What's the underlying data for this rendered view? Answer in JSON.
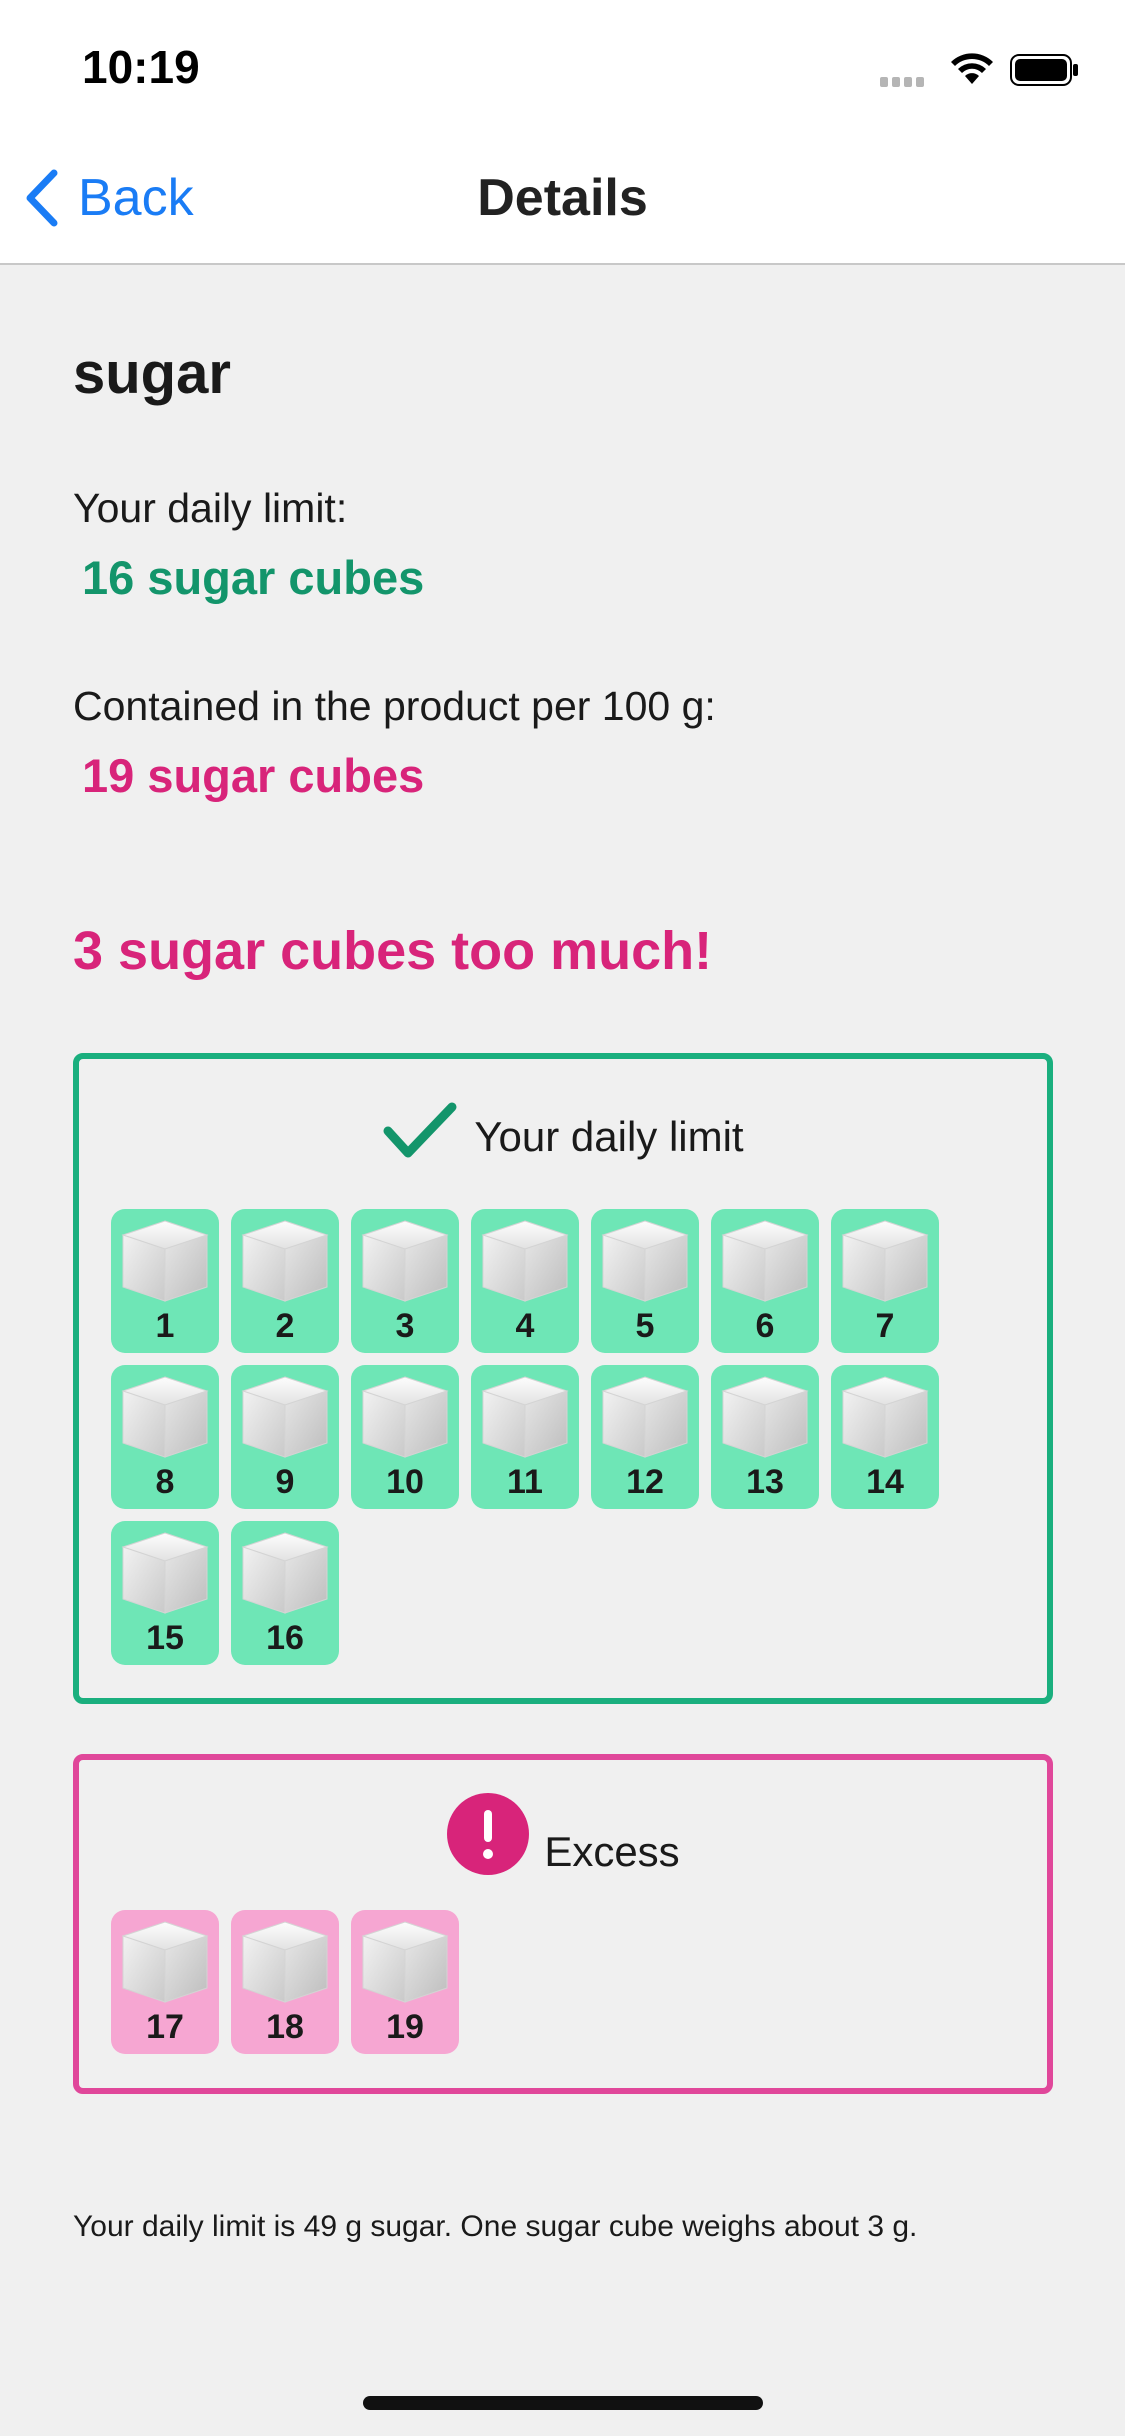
{
  "status_bar": {
    "time": "10:19"
  },
  "nav": {
    "back_label": "Back",
    "title": "Details"
  },
  "product": {
    "name": "sugar"
  },
  "limit": {
    "label": "Your daily limit:",
    "value": "16 sugar cubes"
  },
  "contained": {
    "label": "Contained in the product per 100 g:",
    "value": "19 sugar cubes"
  },
  "verdict": "3 sugar cubes too much!",
  "daily_box": {
    "heading": "Your daily limit",
    "icon": "checkmark-icon",
    "cubes": [
      "1",
      "2",
      "3",
      "4",
      "5",
      "6",
      "7",
      "8",
      "9",
      "10",
      "11",
      "12",
      "13",
      "14",
      "15",
      "16"
    ]
  },
  "excess_box": {
    "heading": "Excess",
    "icon": "exclamation-icon",
    "cubes": [
      "17",
      "18",
      "19"
    ]
  },
  "footnote": "Your daily limit is 49 g sugar. One sugar cube weighs about 3 g.",
  "colors": {
    "accent_green": "#13956b",
    "accent_pink": "#d8247a",
    "link_blue": "#1a7cf5"
  }
}
